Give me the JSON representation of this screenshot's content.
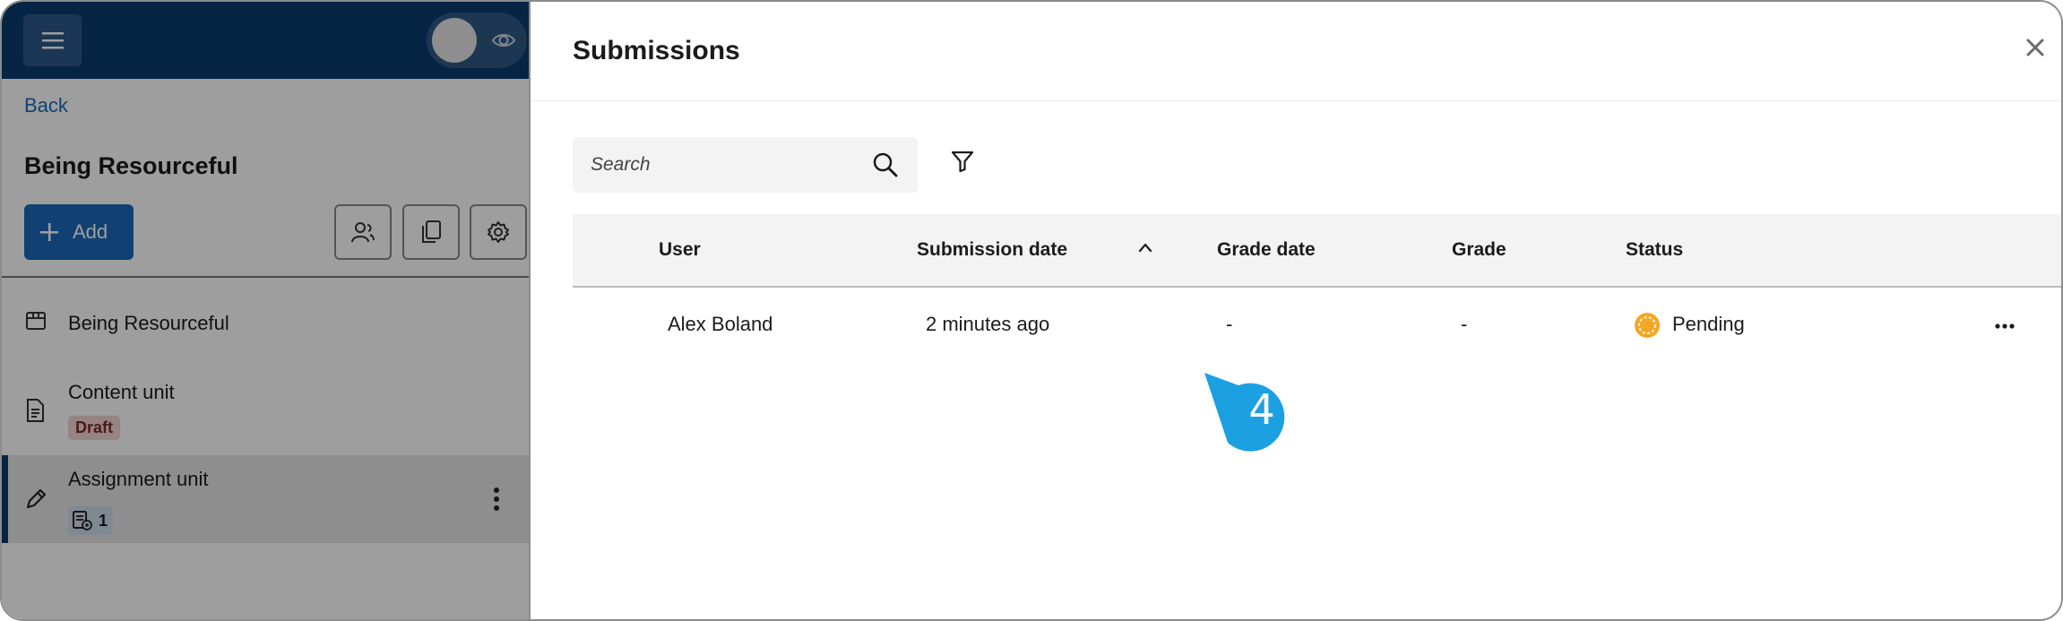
{
  "app": {
    "back_label": "Back",
    "course_title": "Being Resourceful",
    "add_label": "Add",
    "tree": [
      {
        "label": "Being Resourceful"
      },
      {
        "label": "Content unit",
        "badge": "Draft"
      },
      {
        "label": "Assignment unit",
        "count": "1"
      }
    ]
  },
  "panel": {
    "title": "Submissions",
    "search_placeholder": "Search",
    "columns": [
      "User",
      "Submission date",
      "Grade date",
      "Grade",
      "Status"
    ],
    "rows": [
      {
        "user": "Alex Boland",
        "submission_date": "2 minutes ago",
        "grade_date": "-",
        "grade": "-",
        "status": "Pending"
      }
    ]
  },
  "callout": {
    "number": "4"
  },
  "colors": {
    "brand_navy": "#0a3d70",
    "accent_blue": "#1c6ab8",
    "callout_blue": "#1ba0e2",
    "pending_orange": "#f5a623"
  }
}
